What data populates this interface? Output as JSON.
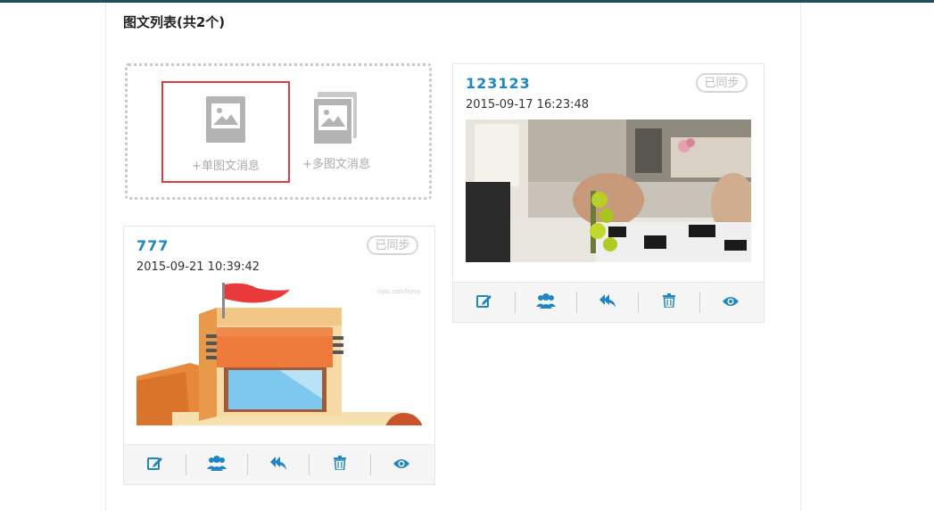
{
  "page": {
    "title": "图文列表(共2个)"
  },
  "add_box": {
    "single_label": "+单图文消息",
    "multi_label": "+多图文消息"
  },
  "cards": [
    {
      "title": "123123",
      "date": "2015-09-17 16:23:48",
      "sync_badge": "已同步",
      "image": "living-room-photo-with-orchids"
    },
    {
      "title": "777",
      "date": "2015-09-21 10:39:42",
      "sync_badge": "已同步",
      "image": "cartoon-building-with-red-flag"
    }
  ],
  "actions": [
    "edit-icon",
    "group-icon",
    "reply-icon",
    "trash-icon",
    "eye-icon"
  ],
  "colors": {
    "accent": "#1f86c6",
    "highlight_border": "#e03a3a",
    "muted": "#aaaaaa",
    "top_bar": "#1f4e5f"
  }
}
